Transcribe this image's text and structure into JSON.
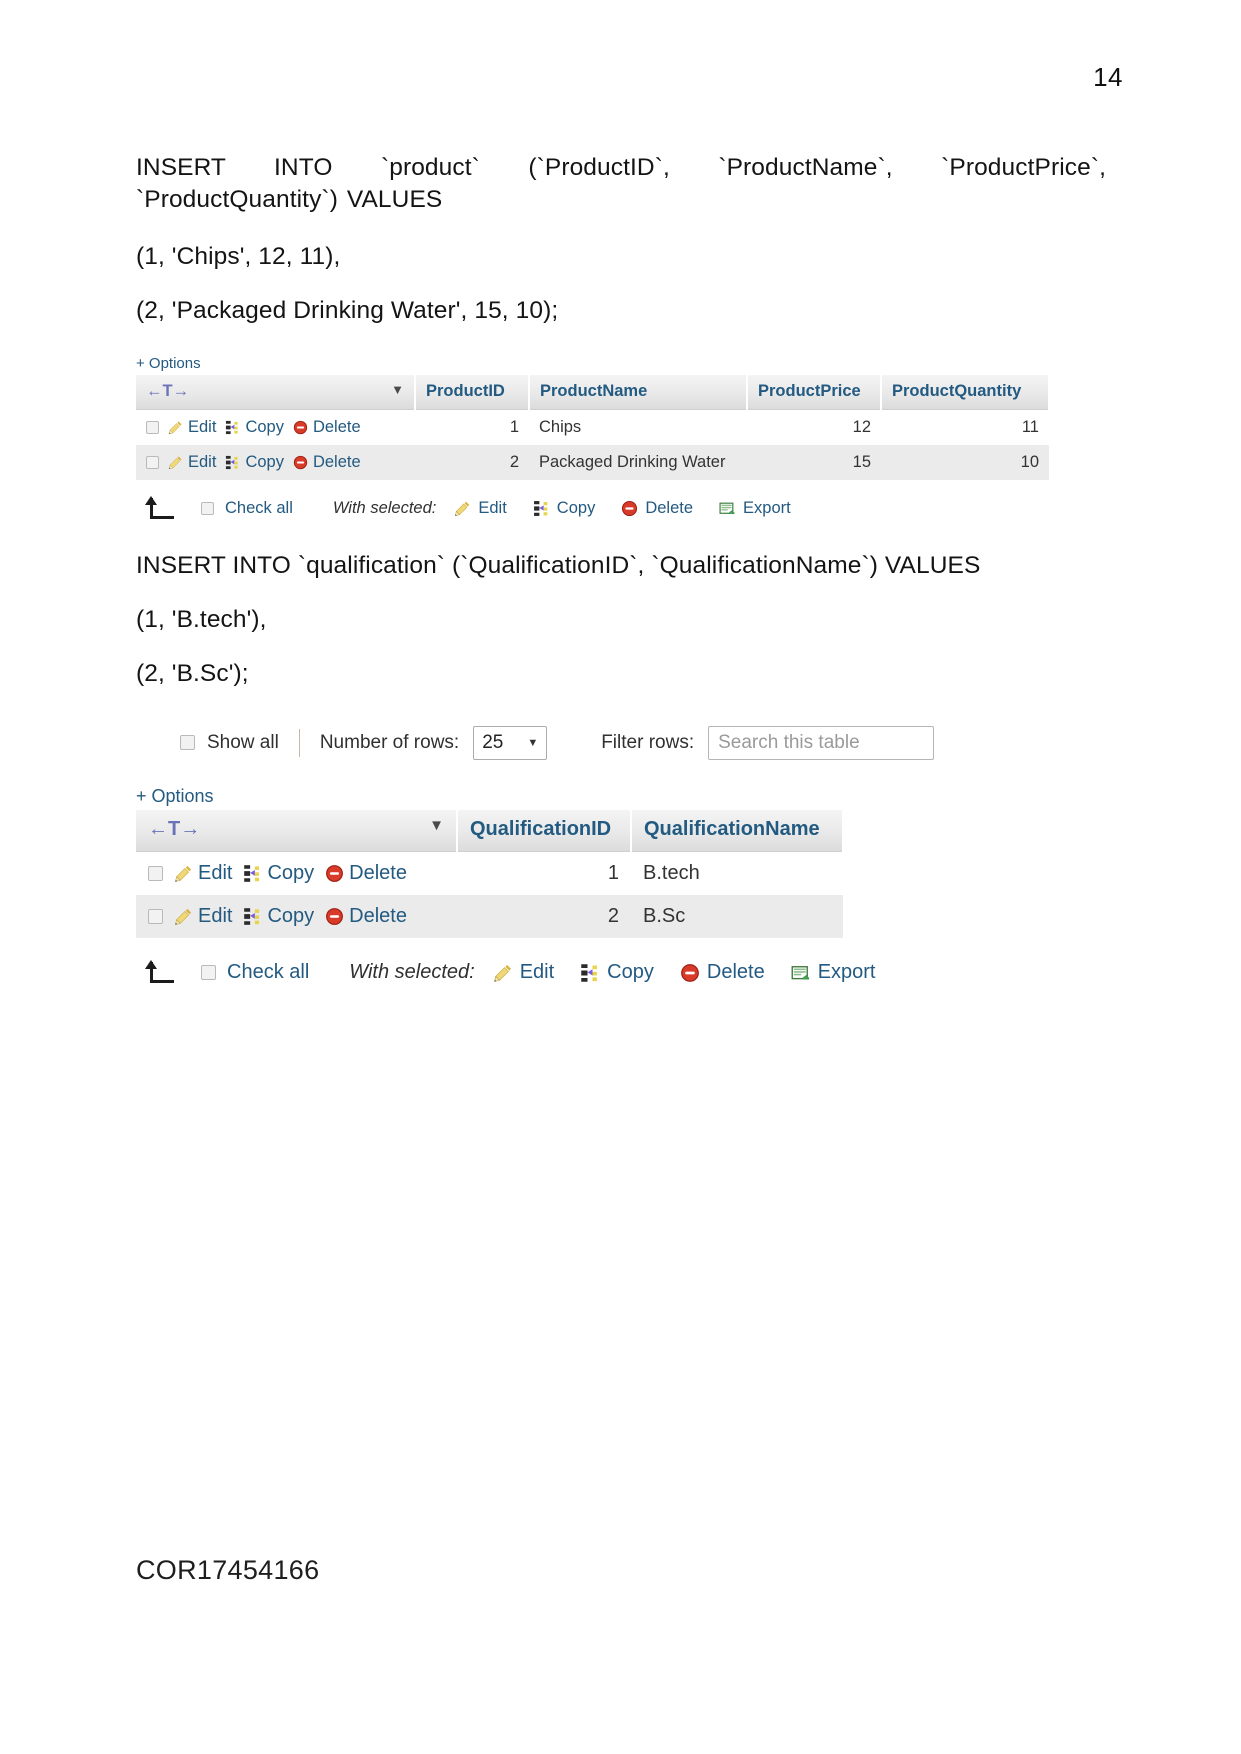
{
  "page": {
    "number": "14",
    "footer_code": "COR17454166"
  },
  "sql_blocks": [
    {
      "statement": "INSERT INTO `product` (`ProductID`, `ProductName`, `ProductPrice`, `ProductQuantity`) VALUES",
      "values": [
        "(1, 'Chips', 12, 11),",
        "(2, 'Packaged Drinking Water', 15, 10);"
      ]
    },
    {
      "statement": "INSERT INTO `qualification` (`QualificationID`, `QualificationName`) VALUES",
      "values": [
        "(1, 'B.tech'),",
        "(2, 'B.Sc');"
      ]
    }
  ],
  "product_result": {
    "options_label": "+ Options",
    "nav_glyph": "←T→",
    "sort_caret": "▼",
    "columns": [
      "ProductID",
      "ProductName",
      "ProductPrice",
      "ProductQuantity"
    ],
    "row_actions": [
      "Edit",
      "Copy",
      "Delete"
    ],
    "rows": [
      {
        "ProductID": "1",
        "ProductName": "Chips",
        "ProductPrice": "12",
        "ProductQuantity": "11"
      },
      {
        "ProductID": "2",
        "ProductName": "Packaged Drinking Water",
        "ProductPrice": "15",
        "ProductQuantity": "10"
      }
    ],
    "toolbar": {
      "check_all": "Check all",
      "with_selected": "With selected:",
      "edit": "Edit",
      "copy": "Copy",
      "delete": "Delete",
      "export": "Export"
    }
  },
  "qualification_controls": {
    "show_all": "Show all",
    "number_of_rows_label": "Number of rows:",
    "number_of_rows_value": "25",
    "number_of_rows_caret": "▼",
    "filter_rows_label": "Filter rows:",
    "filter_placeholder": "Search this table"
  },
  "qualification_result": {
    "options_label": "+ Options",
    "nav_glyph": "←T→",
    "sort_caret": "▼",
    "columns": [
      "QualificationID",
      "QualificationName"
    ],
    "row_actions": [
      "Edit",
      "Copy",
      "Delete"
    ],
    "rows": [
      {
        "QualificationID": "1",
        "QualificationName": "B.tech"
      },
      {
        "QualificationID": "2",
        "QualificationName": "B.Sc"
      }
    ],
    "toolbar": {
      "check_all": "Check all",
      "with_selected": "With selected:",
      "edit": "Edit",
      "copy": "Copy",
      "delete": "Delete",
      "export": "Export"
    }
  },
  "colors": {
    "link": "#235a81",
    "header_text": "#235a81",
    "nav_glyph": "#6a72b8",
    "alt_row": "#ebebeb",
    "pencil": "#e8c33a",
    "delete_red": "#cf2a2a",
    "copy_purple": "#6a4fd0",
    "export_green": "#3f9a4f"
  }
}
